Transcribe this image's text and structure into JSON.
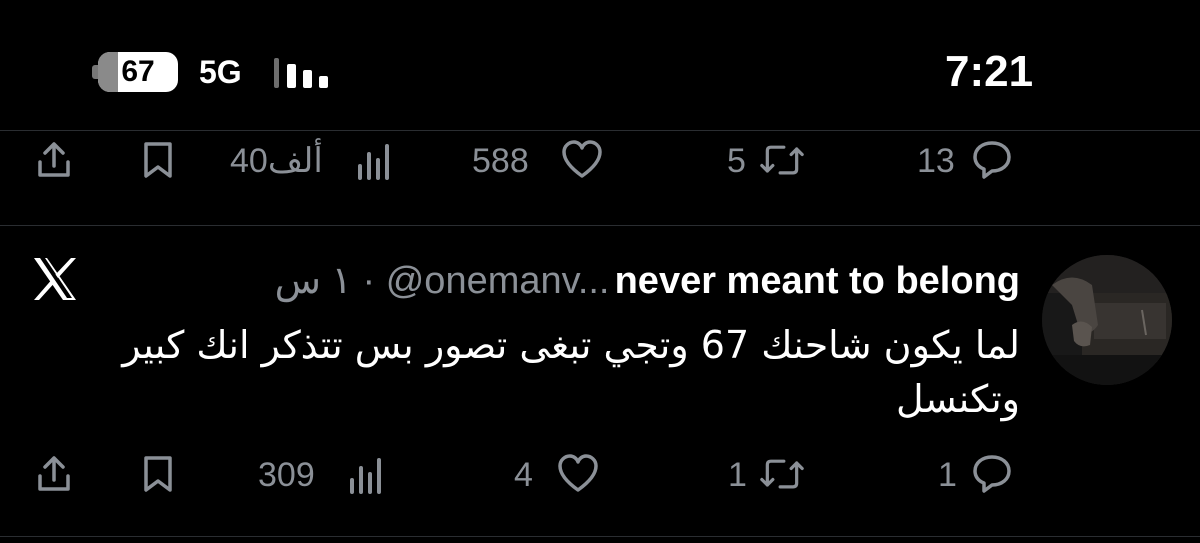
{
  "status_bar": {
    "battery": "67",
    "network": "5G",
    "time": "7:21"
  },
  "previous_tweet_actions": {
    "reply_count": "13",
    "repost_count": "5",
    "like_count": "588",
    "views_count": "40ألف",
    "bookmark_icon": "bookmark-icon",
    "share_icon": "share-icon"
  },
  "tweet": {
    "display_name": "never meant to belong",
    "handle": "@onemanv...",
    "separator": " · ",
    "time_ago": "١ س",
    "text": "لما يكون شاحنك 67 وتجي تبغى تصور بس تتذكر انك كبير وتكنسل",
    "reply_count": "1",
    "repost_count": "1",
    "like_count": "4",
    "views_count": "309"
  },
  "colors": {
    "background": "#000000",
    "muted": "#8b9097",
    "divider": "#2a2d31"
  }
}
